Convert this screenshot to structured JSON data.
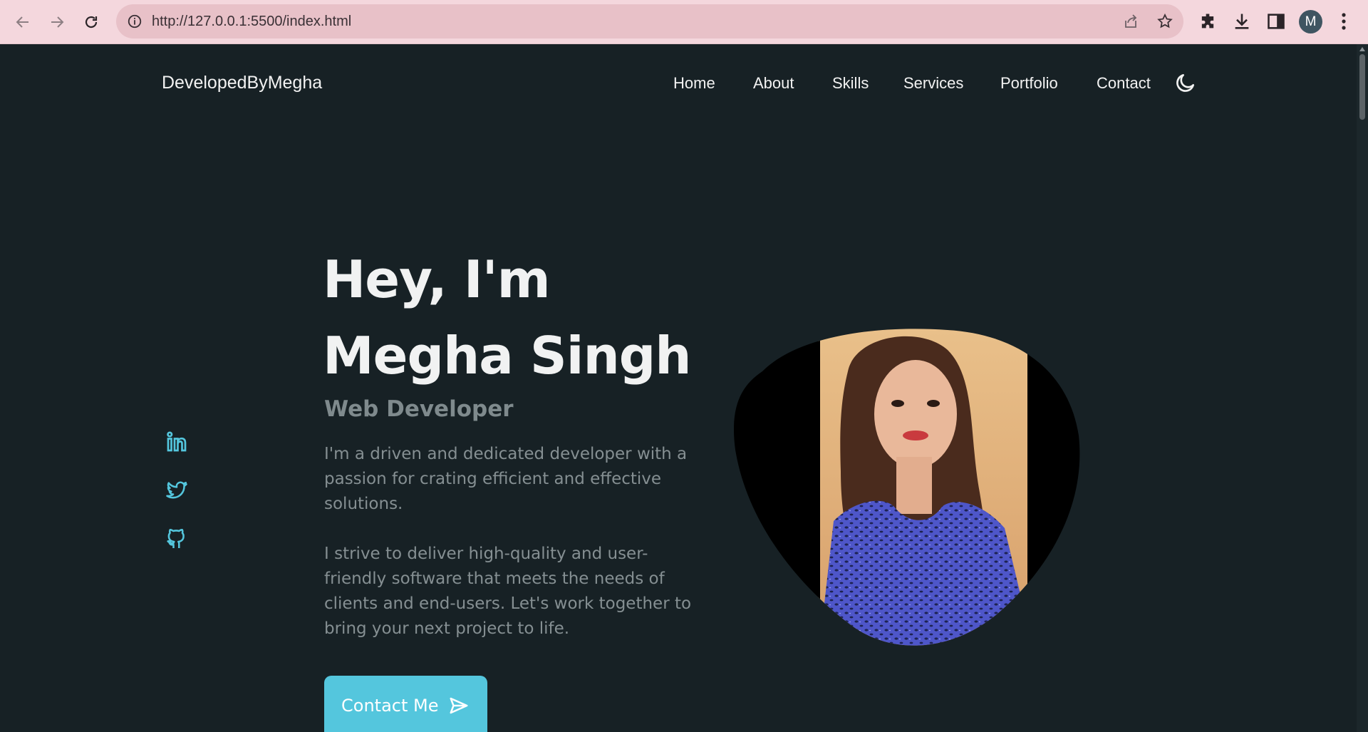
{
  "browser": {
    "url": "http://127.0.0.1:5500/index.html",
    "profile_initial": "M"
  },
  "site": {
    "logo": "DevelopedByMegha",
    "nav": [
      "Home",
      "About",
      "Skills",
      "Services",
      "Portfolio",
      "Contact"
    ],
    "theme_icon": "moon-icon"
  },
  "hero": {
    "title_line1": "Hey, I'm",
    "title_line2": "Megha Singh",
    "subtitle": "Web Developer",
    "para1": "I'm a driven and dedicated developer with a passion for crating efficient and effective solutions.",
    "para2": "I strive to deliver high-quality and user-friendly software that meets the needs of clients and end-users. Let's work together to bring your next project to life.",
    "cta": "Contact Me",
    "cta_icon": "send-icon"
  },
  "social": [
    "linkedin-icon",
    "twitter-icon",
    "github-icon"
  ],
  "colors": {
    "background": "#172125",
    "accent": "#54c6dd",
    "text": "#f1f2f2",
    "muted": "#858f92",
    "chrome": "#f4d7dd"
  }
}
